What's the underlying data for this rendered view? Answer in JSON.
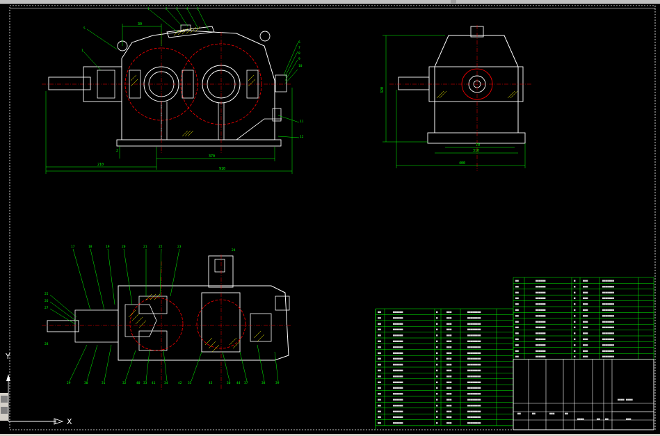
{
  "drawing": {
    "dimensions": {
      "front_top": "30",
      "front_left": "210",
      "front_mid": "370",
      "front_total": "910",
      "front_h": "2",
      "side_w1": "70",
      "side_w2": "310",
      "side_w3": "400",
      "side_h": "320"
    },
    "balloons_top": [
      "1",
      "2",
      "3",
      "4",
      "5"
    ],
    "balloons_left_front": [
      "5",
      "1"
    ],
    "balloons_right_front": [
      "6",
      "7",
      "8",
      "9",
      "10",
      "11",
      "12"
    ],
    "balloons_plan_top": [
      "17",
      "18",
      "19",
      "20",
      "21",
      "22",
      "23",
      "24"
    ],
    "balloons_plan_left": [
      "25",
      "26",
      "27",
      "28"
    ],
    "balloons_plan_bottom": [
      "29",
      "30",
      "31",
      "32",
      "33",
      "34",
      "35",
      "36",
      "37",
      "38",
      "39",
      "40",
      "41",
      "42",
      "43",
      "44"
    ],
    "bom_rows": 20,
    "bom_rows_right": 14
  },
  "ucs": {
    "x_label": "X",
    "y_label": "Y"
  },
  "colors": {
    "background": "#000000",
    "outline": "#ffffff",
    "dimension": "#00ff00",
    "gear": "#ff0000",
    "centerline": "#ff0000",
    "hatch": "#ffff00",
    "frame": "#ffffff"
  }
}
